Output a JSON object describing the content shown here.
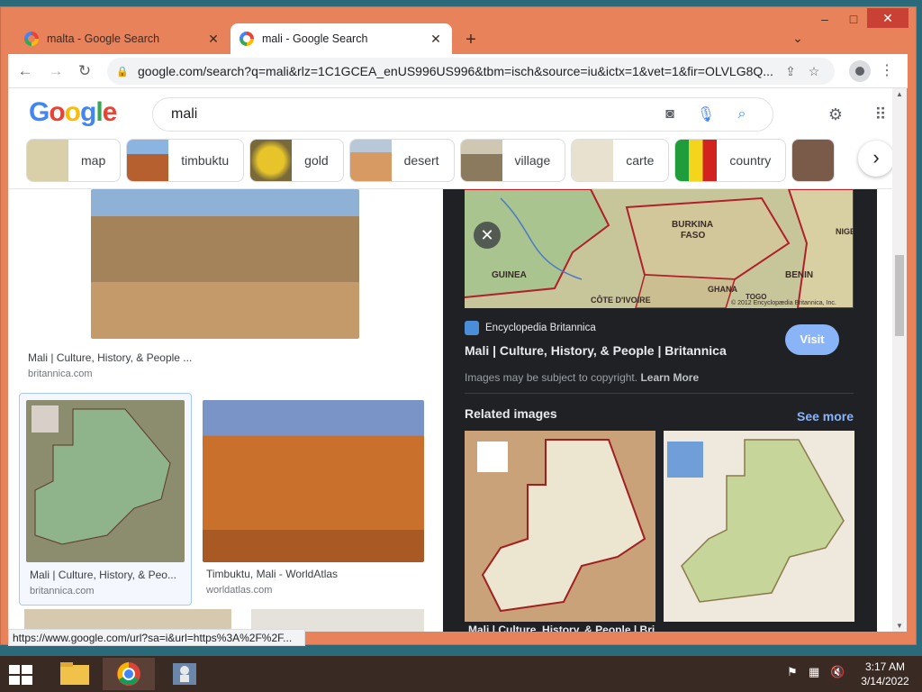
{
  "browser": {
    "tabs": [
      {
        "title": "malta - Google Search",
        "active": false
      },
      {
        "title": "mali - Google Search",
        "active": true
      }
    ],
    "new_tab": "+",
    "url": "google.com/search?q=mali&rlz=1C1GCEA_enUS996US996&tbm=isch&source=iu&ictx=1&vet=1&fir=OLVLG8Q..."
  },
  "google": {
    "logo": "Google",
    "query": "mali",
    "chips": [
      {
        "label": "map",
        "thumb_color": "#d9cfa8"
      },
      {
        "label": "timbuktu",
        "thumb_color": "#b5602e"
      },
      {
        "label": "gold",
        "thumb_color": "#c9a81f"
      },
      {
        "label": "desert",
        "thumb_color": "#d69a62"
      },
      {
        "label": "village",
        "thumb_color": "#8c7a5e"
      },
      {
        "label": "carte",
        "thumb_color": "#e8e1cf"
      },
      {
        "label": "country",
        "thumb_color": "#1f9d3a"
      }
    ]
  },
  "results": [
    {
      "title": "Mali | Culture, History, & People ...",
      "source": "britannica.com"
    },
    {
      "title": "Mali | Culture, History, & Peo...",
      "source": "britannica.com"
    },
    {
      "title": "Timbuktu, Mali - WorldAtlas",
      "source": "worldatlas.com"
    }
  ],
  "panel": {
    "source": "Encyclopedia Britannica",
    "title": "Mali | Culture, History, & People | Britannica",
    "visit": "Visit",
    "copyright": "Images may be subject to copyright.",
    "learn_more": "Learn More",
    "related_heading": "Related images",
    "see_more": "See more",
    "related_caption": "Mali | Culture, History, & People | Bri...",
    "map_labels": [
      "BURKINA",
      "FASO",
      "GUINEA",
      "BENIN",
      "GHANA",
      "CÔTE D'IVOIRE",
      "NIGERIA",
      "TOGO",
      "© 2012 Encyclopædia Britannica, Inc."
    ]
  },
  "status_url": "https://www.google.com/url?sa=i&url=https%3A%2F%2F...",
  "taskbar": {
    "time": "3:17 AM",
    "date": "3/14/2022"
  },
  "colors": {
    "window_frame": "#e8825a",
    "close_red": "#c94034",
    "panel_dark": "#202124",
    "link_blue": "#8ab4f8"
  }
}
